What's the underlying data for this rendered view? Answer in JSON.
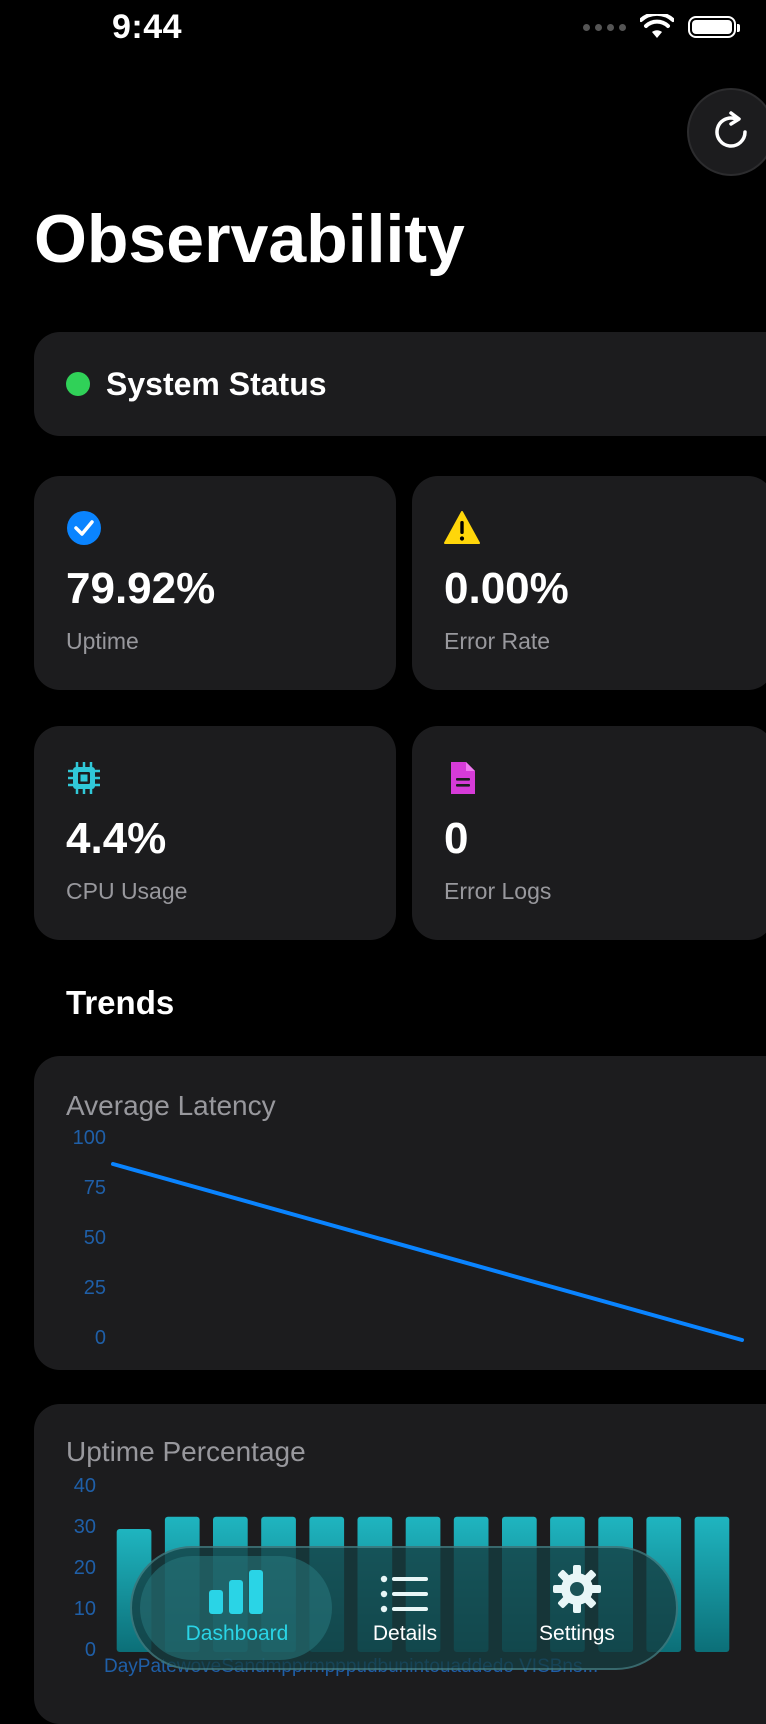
{
  "status_bar": {
    "time": "9:44"
  },
  "header": {
    "title": "Observability",
    "refresh_icon": "refresh-icon"
  },
  "system_status": {
    "label": "System Status",
    "status_color": "#30d158"
  },
  "metrics": [
    {
      "icon": "checkmark-circle-icon",
      "value": "79.92%",
      "label": "Uptime",
      "color": "#0a84ff"
    },
    {
      "icon": "warning-triangle-icon",
      "value": "0.00%",
      "label": "Error Rate",
      "color": "#ffd60a"
    },
    {
      "icon": "cpu-chip-icon",
      "value": "4.4%",
      "label": "CPU Usage",
      "color": "#30c8d8"
    },
    {
      "icon": "document-icon",
      "value": "0",
      "label": "Error Logs",
      "color": "#d63bd8"
    }
  ],
  "trends": {
    "title": "Trends"
  },
  "chart_data": [
    {
      "type": "line",
      "title": "Average Latency",
      "y_ticks": [
        "100",
        "75",
        "50",
        "25",
        "0"
      ],
      "ylim": [
        0,
        100
      ],
      "x": [
        0,
        1
      ],
      "values": [
        88,
        0
      ],
      "color": "#0a84ff"
    },
    {
      "type": "bar",
      "title": "Uptime Percentage",
      "y_ticks": [
        "40",
        "30",
        "20",
        "10",
        "0"
      ],
      "ylim": [
        0,
        40
      ],
      "values": [
        30,
        33,
        33,
        33,
        33,
        33,
        33,
        33,
        33,
        33,
        33,
        33,
        33
      ],
      "color": "#1fb5c0",
      "x_label_text": "DayPatewoveSandmpprmpppudbunintouaddedo VISBns..."
    }
  ],
  "tabbar": {
    "tabs": [
      {
        "label": "Dashboard",
        "icon": "bar-chart-icon",
        "active": true
      },
      {
        "label": "Details",
        "icon": "list-icon",
        "active": false
      },
      {
        "label": "Settings",
        "icon": "gear-icon",
        "active": false
      }
    ]
  }
}
